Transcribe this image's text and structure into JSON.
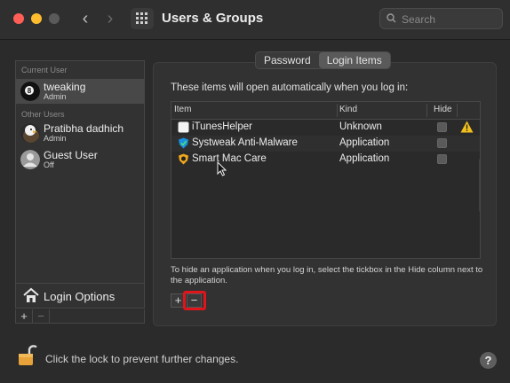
{
  "window": {
    "title": "Users & Groups"
  },
  "search": {
    "placeholder": "Search",
    "value": ""
  },
  "sidebar": {
    "current_user_label": "Current User",
    "other_users_label": "Other Users",
    "users": [
      {
        "name": "tweaking",
        "role": "Admin",
        "selected": true
      },
      {
        "name": "Pratibha dadhich",
        "role": "Admin",
        "selected": false
      },
      {
        "name": "Guest User",
        "role": "Off",
        "selected": false
      }
    ],
    "login_options_label": "Login Options",
    "add_label": "+",
    "remove_label": "−"
  },
  "tabs": [
    {
      "label": "Password",
      "active": false
    },
    {
      "label": "Login Items",
      "active": true
    }
  ],
  "login_items": {
    "intro": "These items will open automatically when you log in:",
    "columns": {
      "item": "Item",
      "kind": "Kind",
      "hide": "Hide"
    },
    "rows": [
      {
        "name": "iTunesHelper",
        "kind": "Unknown",
        "hide": false,
        "warning": true
      },
      {
        "name": "Systweak Anti-Malware",
        "kind": "Application",
        "hide": false,
        "warning": false
      },
      {
        "name": "Smart Mac Care",
        "kind": "Application",
        "hide": false,
        "warning": false
      }
    ],
    "help_text": "To hide an application when you log in, select the tickbox in the Hide column next to the application.",
    "add_label": "+",
    "remove_label": "−"
  },
  "footer": {
    "lock_text": "Click the lock to prevent further changes.",
    "help_label": "?"
  },
  "colors": {
    "close": "#ff5f57",
    "minimize": "#febc2e",
    "highlight": "#e0141b"
  }
}
